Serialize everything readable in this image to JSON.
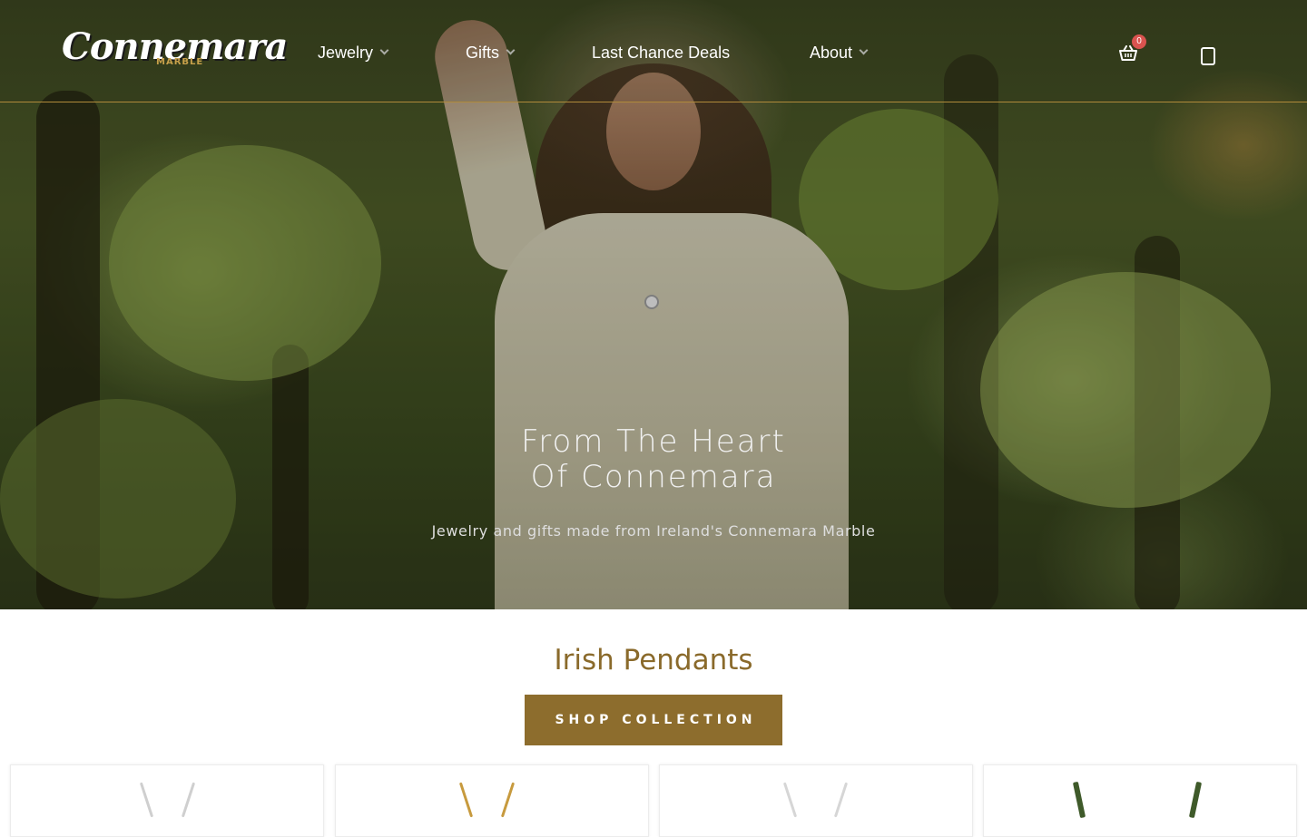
{
  "brand": {
    "logo_text": "Connemara",
    "logo_subtext": "MARBLE"
  },
  "nav": {
    "items": [
      {
        "label": "Jewelry",
        "has_dropdown": true
      },
      {
        "label": "Gifts",
        "has_dropdown": true
      },
      {
        "label": "Last Chance Deals",
        "has_dropdown": false
      },
      {
        "label": "About",
        "has_dropdown": true
      }
    ]
  },
  "cart": {
    "count": "0",
    "icon": "basket-icon"
  },
  "account": {
    "icon": "account-icon"
  },
  "hero": {
    "title": "From The Heart\nOf Connemara",
    "subtitle": "Jewelry and gifts made from Ireland's Connemara Marble"
  },
  "collection": {
    "title": "Irish Pendants",
    "button_label": "SHOP COLLECTION",
    "product_cards": [
      {
        "chain_color": "#cfcfcf"
      },
      {
        "chain_color": "#c79a3e"
      },
      {
        "chain_color": "#d6d6d6"
      },
      {
        "chain_color": "#3f5a2a"
      }
    ]
  },
  "colors": {
    "accent": "#8d6d2d",
    "heading": "#8a6a2b",
    "header_border": "#b08a3a",
    "cart_badge": "#d9534f"
  }
}
